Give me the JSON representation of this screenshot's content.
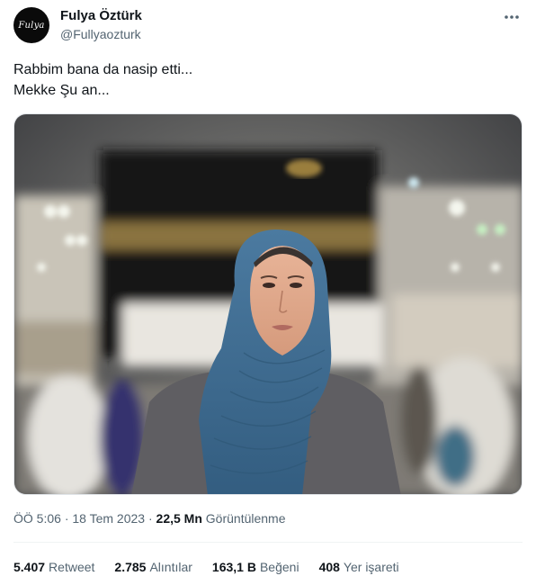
{
  "author": {
    "display_name": "Fulya Öztürk",
    "handle": "@Fullyaozturk",
    "avatar_logo": "Fulya",
    "avatar_icon": "avatar-logo",
    "more_icon": "more-horizontal-icon"
  },
  "tweet": {
    "lines": [
      "Rabbim bana da nasip etti...",
      "Mekke Şu an..."
    ]
  },
  "media": {
    "alt": "photo-woman-in-blue-hijab-at-kaaba"
  },
  "meta": {
    "time": "ÖÖ 5:06",
    "separator": "·",
    "date": "18 Tem 2023",
    "views_value": "22,5 Mn",
    "views_label": "Görüntülenme"
  },
  "stats": [
    {
      "value": "5.407",
      "label": "Retweet"
    },
    {
      "value": "2.785",
      "label": "Alıntılar"
    },
    {
      "value": "163,1 B",
      "label": "Beğeni"
    },
    {
      "value": "408",
      "label": "Yer işareti"
    }
  ],
  "colors": {
    "text": "#0f1419",
    "secondary": "#536471",
    "divider": "#eff3f4",
    "hijab": "#3f6f93"
  }
}
